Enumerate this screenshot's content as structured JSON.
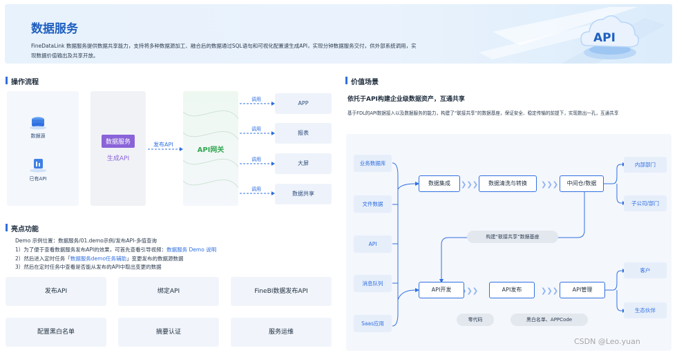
{
  "banner": {
    "title": "数据服务",
    "description": "FineDataLink 数据服务提供数据共享能力，支持将多种数据源加工、融合后的数据通过SQL语句和可视化配置速生成API，实现分钟数据服务交付，供外部系统调用，实现数据价值输出及共享开放。",
    "art_text": "API"
  },
  "flow": {
    "section_title": "操作流程",
    "sources": [
      "数据源",
      "已有API"
    ],
    "generate_tag": "数据服务",
    "generate_sub": "生成API",
    "publish_label": "发布API",
    "gateway_label": "API网关",
    "call_label": "调用",
    "targets": [
      "APP",
      "报表",
      "大屏",
      "数据共享"
    ]
  },
  "highlights": {
    "section_title": "亮点功能",
    "demo_location": "Demo 示例位置：数据服务/01.demo示例/发布API-多值查询",
    "step1_text": "1）为了便于查看数据服务发布API的效果，可首先查看引导视频：",
    "step1_link": "数据服务 Demo 说明",
    "step2_prefix": "2）然后进入定时任务「",
    "step2_link": "数据服务demo任务辅助",
    "step2_suffix": "」变更发布的数据源数据",
    "step3_text": "3）然后在定时任务中查看是否能从发布的API中取出变更的数据",
    "features": [
      "发布API",
      "绑定API",
      "FineBI数据发布API",
      "配置黑白名单",
      "摘要认证",
      "服务运维"
    ]
  },
  "value": {
    "section_title": "价值场景",
    "headline": "依托于API构建企业级数据资产，互通共享",
    "description": "基于FDL的API数据接入以及数据服务的能力，构建了“联接共享”的数据基座，保证安全、稳定传输的前提下，实现数出一孔，互通共享",
    "sources": [
      "业务数据库",
      "文件数据",
      "API",
      "消息队列",
      "Saas应用"
    ],
    "top_nodes": [
      "数据集成",
      "数据清洗与转换",
      "中间仓/数据"
    ],
    "base_pill": "构建“联接共享”数据基座",
    "bottom_nodes": [
      "API开发",
      "API发布",
      "API管理"
    ],
    "bottom_pills": [
      "零代码",
      "黑白名单、APPCode"
    ],
    "outputs_top": [
      "内部部门",
      "子公司/部门"
    ],
    "outputs_bottom": [
      "客户",
      "生态伙伴"
    ]
  },
  "watermark": "CSDN @Leo.yuan",
  "colors": {
    "accent": "#2f6fe0",
    "purple": "#8a63d8",
    "green": "#34a853"
  }
}
